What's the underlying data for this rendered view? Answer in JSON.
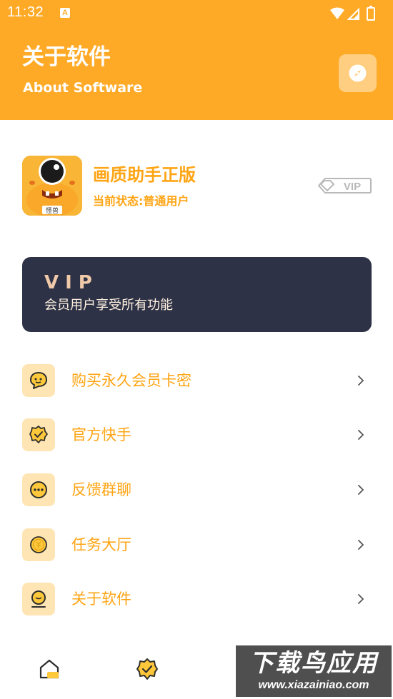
{
  "status_bar": {
    "time": "11:32",
    "notification_letter": "A"
  },
  "header": {
    "title": "关于软件",
    "subtitle": "About Software",
    "action_icon": "compass-icon",
    "bg_color": "#FFAA27"
  },
  "app": {
    "name": "画质助手正版",
    "status": "当前状态:普通用户",
    "badge_text": "VIP",
    "icon_label": "怪兽"
  },
  "vip_card": {
    "title": "VIP",
    "description": "会员用户享受所有功能"
  },
  "menu": {
    "items": [
      {
        "label": "购买永久会员卡密",
        "icon": "chat-bubble-icon"
      },
      {
        "label": "官方快手",
        "icon": "verified-badge-icon"
      },
      {
        "label": "反馈群聊",
        "icon": "more-dots-icon"
      },
      {
        "label": "任务大厅",
        "icon": "coin-icon"
      },
      {
        "label": "关于软件",
        "icon": "about-icon"
      }
    ]
  },
  "bottom_nav": {
    "items": [
      {
        "icon": "home-icon"
      },
      {
        "icon": "verified-badge-icon"
      }
    ]
  },
  "watermark": {
    "cn": "下载鸟应用",
    "en": "www.xiazainiao.com"
  },
  "colors": {
    "accent": "#FFAA27",
    "text_orange": "#FFA515",
    "card_dark": "#2E3247",
    "icon_bg": "#FEE5B3"
  }
}
